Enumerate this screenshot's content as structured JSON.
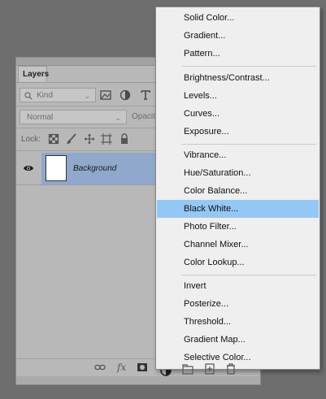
{
  "layers_panel": {
    "tab_label": "Layers",
    "filter_select": {
      "value": "Kind"
    },
    "blend_select": {
      "value": "Normal"
    },
    "opacity_label": "Opacit",
    "lock_label": "Lock:",
    "layers": [
      {
        "name": "Background",
        "visible": true,
        "selected": true
      }
    ]
  },
  "menu": {
    "groups": [
      [
        "Solid Color...",
        "Gradient...",
        "Pattern..."
      ],
      [
        "Brightness/Contrast...",
        "Levels...",
        "Curves...",
        "Exposure..."
      ],
      [
        "Vibrance...",
        "Hue/Saturation...",
        "Color Balance...",
        "Black  White...",
        "Photo Filter...",
        "Channel Mixer...",
        "Color Lookup..."
      ],
      [
        "Invert",
        "Posterize...",
        "Threshold...",
        "Gradient Map...",
        "Selective Color..."
      ]
    ],
    "highlighted_item": "Black  White...",
    "colors": {
      "highlight": "#93c8f5",
      "background": "#efefef"
    }
  },
  "icons": {
    "filter_icons": [
      "image-filter-icon",
      "adjustment-filter-icon",
      "type-filter-icon"
    ],
    "lock_icons": [
      "lock-transparent-icon",
      "lock-paint-icon",
      "lock-move-icon",
      "artboard-icon",
      "lock-all-icon"
    ],
    "bottom_icons": [
      "link-icon",
      "fx-icon",
      "mask-icon",
      "adjustment-icon",
      "group-icon",
      "new-layer-icon",
      "trash-icon"
    ]
  }
}
